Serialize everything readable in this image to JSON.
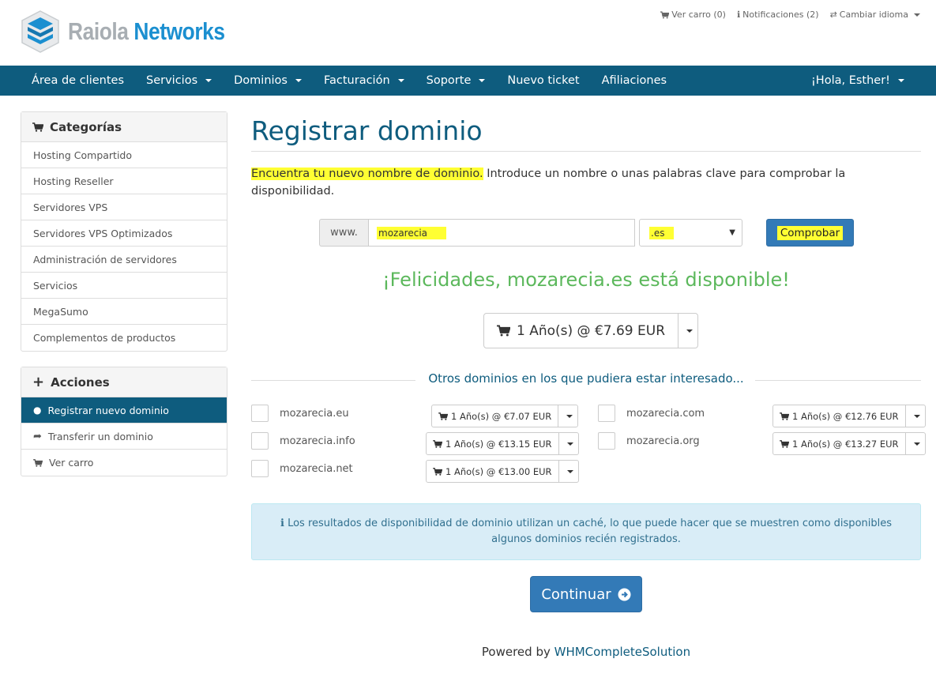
{
  "brand": {
    "name_a": "Raiola",
    "name_b": "Networks"
  },
  "top_links": {
    "cart": "Ver carro (0)",
    "notifications": "Notificaciones (2)",
    "language": "Cambiar idioma"
  },
  "nav": {
    "items": [
      {
        "label": "Área de clientes"
      },
      {
        "label": "Servicios"
      },
      {
        "label": "Dominios"
      },
      {
        "label": "Facturación"
      },
      {
        "label": "Soporte"
      },
      {
        "label": "Nuevo ticket"
      },
      {
        "label": "Afiliaciones"
      }
    ],
    "user": "¡Hola, Esther!"
  },
  "sidebar": {
    "categories_title": "Categorías",
    "categories": [
      "Hosting Compartido",
      "Hosting Reseller",
      "Servidores VPS",
      "Servidores VPS Optimizados",
      "Administración de servidores",
      "Servicios",
      "MegaSumo",
      "Complementos de productos"
    ],
    "actions_title": "Acciones",
    "actions": [
      {
        "label": "Registrar nuevo dominio"
      },
      {
        "label": "Transferir un dominio"
      },
      {
        "label": "Ver carro"
      }
    ]
  },
  "main": {
    "title": "Registrar dominio",
    "intro_highlight": "Encuentra tu nuevo nombre de dominio.",
    "intro_rest": " Introduce un nombre o unas palabras clave para comprobar la disponibilidad.",
    "prefix": "www.",
    "domain_value": "mozarecia",
    "tld_value": ".es",
    "check_label": "Comprobar",
    "success": "¡Felicidades, mozarecia.es está disponible!",
    "main_price": "1 Año(s) @ €7.69 EUR",
    "others_title": "Otros dominios en los que pudiera estar interesado...",
    "suggestions": [
      {
        "name": "mozarecia.eu",
        "price": "1 Año(s) @ €7.07 EUR"
      },
      {
        "name": "mozarecia.com",
        "price": "1 Año(s) @ €12.76 EUR"
      },
      {
        "name": "mozarecia.info",
        "price": "1 Año(s) @ €13.15 EUR"
      },
      {
        "name": "mozarecia.org",
        "price": "1 Año(s) @ €13.27 EUR"
      },
      {
        "name": "mozarecia.net",
        "price": "1 Año(s) @ €13.00 EUR"
      }
    ],
    "info": "Los resultados de disponibilidad de dominio utilizan un caché, lo que puede hacer que se muestren como disponibles algunos dominios recién registrados.",
    "continue_label": "Continuar",
    "footer_text": "Powered by ",
    "footer_link": "WHMCompleteSolution"
  },
  "colors": {
    "primary": "#0e5c7e",
    "button": "#337ab7",
    "success": "#5cb85c",
    "highlight": "#ffff33",
    "info_bg": "#d9edf7"
  }
}
